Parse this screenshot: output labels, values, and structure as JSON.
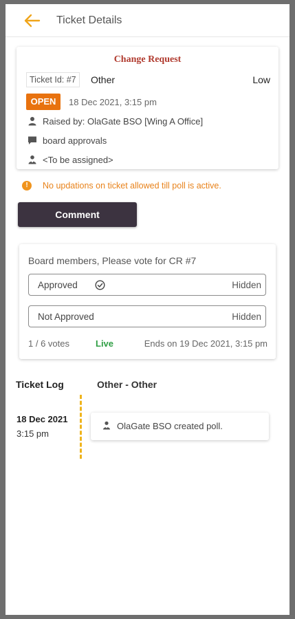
{
  "header": {
    "title": "Ticket Details",
    "back_icon": "arrow-left-icon",
    "accent_color": "#f0a51a"
  },
  "ticket": {
    "type_title": "Change Request",
    "id_label": "Ticket Id: #7",
    "category": "Other",
    "priority": "Low",
    "status": "OPEN",
    "created": "18 Dec 2021, 3:15 pm",
    "raised_by": "Raised by: OlaGate BSO [Wing A Office]",
    "subcategory": "board approvals",
    "assignee": "<To be assigned>",
    "status_color": "#e8720f",
    "title_color": "#b03a2e"
  },
  "warning": {
    "text": "No updations on ticket allowed till poll is active.",
    "icon": "info-icon",
    "color": "#e8821a"
  },
  "comment_button": {
    "label": "Comment"
  },
  "poll": {
    "question": "Board members, Please vote for CR #7",
    "options": [
      {
        "label": "Approved",
        "result": "Hidden",
        "selected": true
      },
      {
        "label": "Not Approved",
        "result": "Hidden",
        "selected": false
      }
    ],
    "votes": "1 / 6 votes",
    "state": "Live",
    "ends": "Ends on 19 Dec 2021, 3:15 pm",
    "live_color": "#2f9e44"
  },
  "log": {
    "title": "Ticket Log",
    "filter": "Other - Other",
    "entries": [
      {
        "date": "18 Dec 2021",
        "time": "3:15 pm",
        "text": "OlaGate BSO created poll."
      }
    ],
    "line_color": "#efb41c"
  }
}
